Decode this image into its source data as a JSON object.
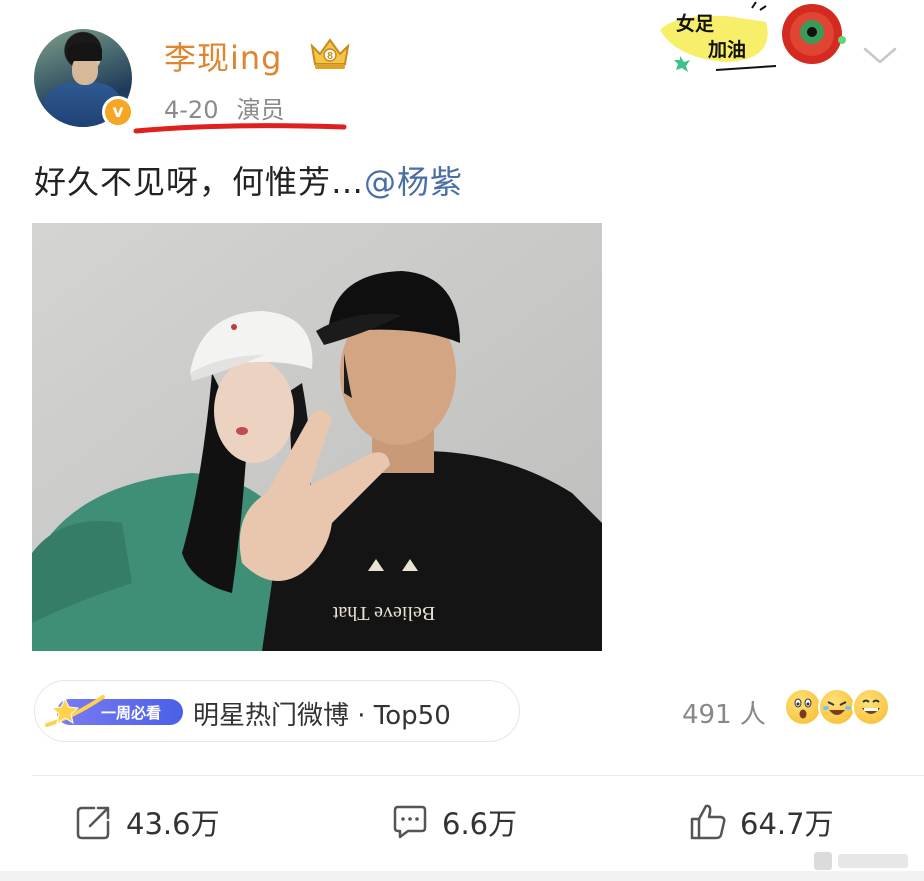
{
  "post": {
    "username": "李现ing",
    "date": "4-20",
    "tag": "演员",
    "text_main": "好久不见呀，何惟芳…",
    "mention": "@杨紫"
  },
  "sticker": {
    "line1": "女足",
    "line2": "加油"
  },
  "photo": {
    "shirt_text": "Believe That"
  },
  "hot_pill": {
    "badge_label": "一周必看",
    "label": "明星热门微博 · Top50"
  },
  "reactions": {
    "count": "491 人",
    "emojis": [
      "surprised-emoji-icon",
      "laughing-rolling-emoji-icon",
      "grinning-emoji-icon"
    ]
  },
  "actions": {
    "share_count": "43.6万",
    "comment_count": "6.6万",
    "like_count": "64.7万"
  },
  "colors": {
    "username": "#e0852d",
    "mention": "#4a6fa5",
    "underline": "#e01f1f",
    "verified": "#f6a623"
  }
}
